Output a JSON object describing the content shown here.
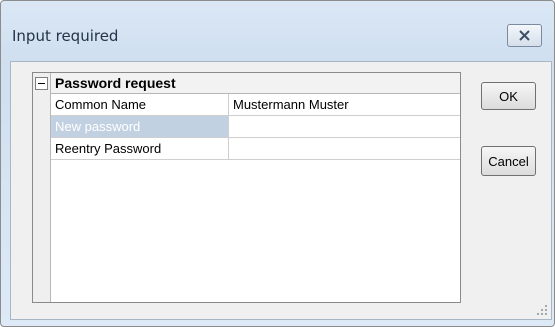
{
  "window": {
    "title": "Input required"
  },
  "property_grid": {
    "group_title": "Password request",
    "rows": [
      {
        "name": "Common Name",
        "value": "Mustermann Muster",
        "selected": false
      },
      {
        "name": "New password",
        "value": "",
        "selected": true
      },
      {
        "name": "Reentry Password",
        "value": "",
        "selected": false
      }
    ]
  },
  "buttons": {
    "ok_label": "OK",
    "cancel_label": "Cancel"
  },
  "icons": {
    "close": "close-icon",
    "collapse": "collapse-minus-icon",
    "resize": "resize-grip-icon"
  },
  "colors": {
    "selection": "#c2d1e2",
    "window_chrome": "#d6e3f2"
  }
}
